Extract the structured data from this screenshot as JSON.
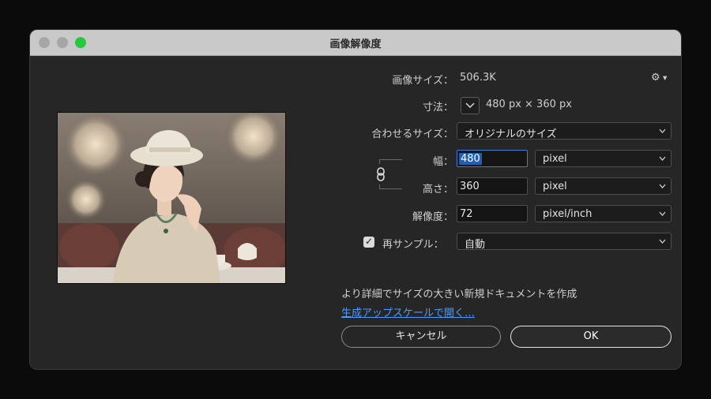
{
  "window": {
    "title": "画像解像度"
  },
  "image_size": {
    "label": "画像サイズ：",
    "value": "506.3K"
  },
  "dimensions": {
    "label": "寸法：",
    "value": "480 px × 360 px"
  },
  "fit_to": {
    "label": "合わせるサイズ：",
    "value": "オリジナルのサイズ"
  },
  "width": {
    "label": "幅：",
    "value": "480",
    "unit": "pixel"
  },
  "height": {
    "label": "高さ：",
    "value": "360",
    "unit": "pixel"
  },
  "resolution": {
    "label": "解像度：",
    "value": "72",
    "unit": "pixel/inch"
  },
  "resample": {
    "label": "再サンプル：",
    "checked": true,
    "value": "自動"
  },
  "info_text": "より詳細でサイズの大きい新規ドキュメントを作成",
  "upscale_link": "生成アップスケールで開く…",
  "buttons": {
    "cancel": "キャンセル",
    "ok": "OK"
  },
  "icons": {
    "settings": "gear-icon",
    "dimensions_toggle": "chevron-down-icon",
    "constrain": "chain-link-icon",
    "checkbox": "checkmark-icon"
  },
  "colors": {
    "accent_blue": "#4c9bff",
    "zoom_green": "#27c840",
    "focus_blue": "#3f7fd8"
  }
}
